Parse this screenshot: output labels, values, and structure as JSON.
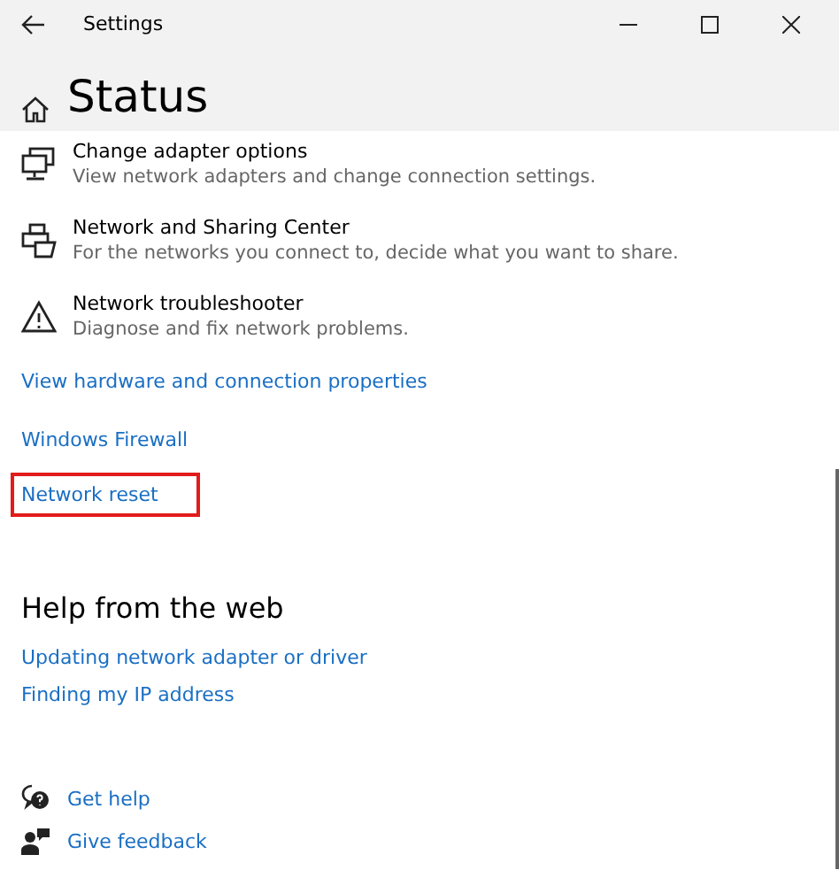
{
  "window": {
    "title": "Settings"
  },
  "page": {
    "title": "Status"
  },
  "items": [
    {
      "kind": "adapter",
      "title": "Change adapter options",
      "description": "View network adapters and change connection settings."
    },
    {
      "kind": "sharing",
      "title": "Network and Sharing Center",
      "description": "For the networks you connect to, decide what you want to share."
    },
    {
      "kind": "troubleshoot",
      "title": "Network troubleshooter",
      "description": "Diagnose and fix network problems."
    }
  ],
  "links": [
    {
      "label": "View hardware and connection properties",
      "highlighted": false
    },
    {
      "label": "Windows Firewall",
      "highlighted": false
    },
    {
      "label": "Network reset",
      "highlighted": true
    }
  ],
  "help": {
    "heading": "Help from the web",
    "links": [
      "Updating network adapter or driver",
      "Finding my IP address"
    ]
  },
  "footer": [
    {
      "kind": "help",
      "label": "Get help"
    },
    {
      "kind": "feedback",
      "label": "Give feedback"
    }
  ]
}
